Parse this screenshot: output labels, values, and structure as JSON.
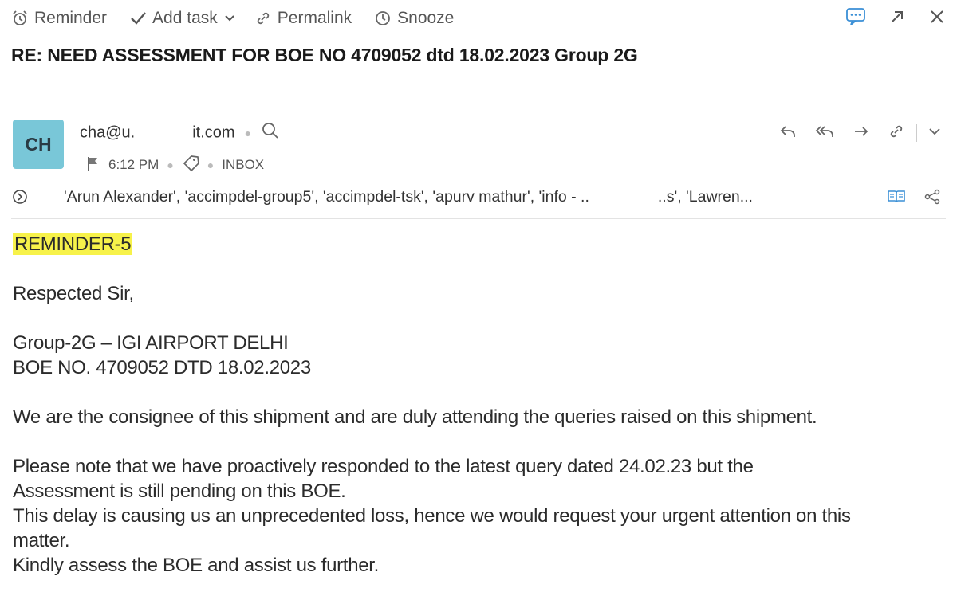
{
  "toolbar": {
    "reminder": "Reminder",
    "add_task": "Add task",
    "permalink": "Permalink",
    "snooze": "Snooze"
  },
  "subject": "RE: NEED ASSESSMENT FOR BOE NO 4709052 dtd 18.02.2023 Group 2G",
  "sender": {
    "initials": "CH",
    "email_start": "cha@u.",
    "email_end": "it.com",
    "time": "6:12 PM",
    "folder": "INBOX"
  },
  "recipients": "'Arun Alexander', 'accimpdel-group5', 'accimpdel-tsk', 'apurv mathur', 'info - ..",
  "recipients_tail": "..s', 'Lawren...",
  "body": {
    "tag": "REMINDER-5",
    "greeting": "Respected Sir,",
    "line_group": "Group-2G – IGI AIRPORT DELHI",
    "line_boe": "BOE NO. 4709052 DTD 18.02.2023",
    "para1": "We are the consignee of this shipment and are duly attending the queries raised on this shipment.",
    "para2a": "Please note that we have proactively responded to the latest query dated 24.02.23 but the",
    "para2b": "Assessment is still pending on this BOE.",
    "para3a": "This delay is causing us an unprecedented loss, hence we would request your urgent attention on this",
    "para3b": "matter.",
    "para4": "Kindly assess the BOE and assist us further."
  },
  "colors": {
    "avatar_bg": "#79c7d8",
    "highlight": "#f7f24a",
    "comment_icon": "#3a8fd6"
  }
}
